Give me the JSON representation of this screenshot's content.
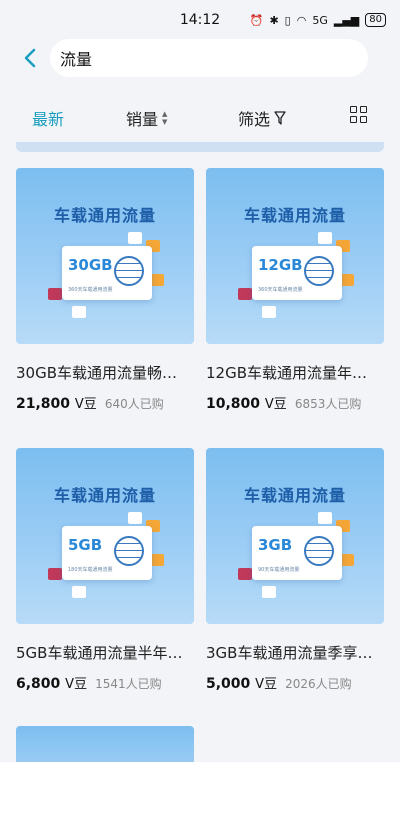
{
  "status": {
    "time": "14:12",
    "network": "5G",
    "battery": "80"
  },
  "header": {
    "search_text": "流量"
  },
  "filters": {
    "newest": "最新",
    "sales": "销量",
    "filter": "筛选"
  },
  "products": [
    {
      "image_title": "车载通用流量",
      "card_gb": "30GB",
      "card_sub": "360天车载通用流量",
      "name": "30GB车载通用流量畅…",
      "price": "21,800",
      "unit": "V豆",
      "sold": "640人已购"
    },
    {
      "image_title": "车载通用流量",
      "card_gb": "12GB",
      "card_sub": "360天车载通用流量",
      "name": "12GB车载通用流量年…",
      "price": "10,800",
      "unit": "V豆",
      "sold": "6853人已购"
    },
    {
      "image_title": "车载通用流量",
      "card_gb": "5GB",
      "card_sub": "180天车载通用流量",
      "name": "5GB车载通用流量半年…",
      "price": "6,800",
      "unit": "V豆",
      "sold": "1541人已购"
    },
    {
      "image_title": "车载通用流量",
      "card_gb": "3GB",
      "card_sub": "90天车载通用流量",
      "name": "3GB车载通用流量季享…",
      "price": "5,000",
      "unit": "V豆",
      "sold": "2026人已购"
    }
  ],
  "colors": {
    "accent": "#1a9ec0",
    "background": "#f2f4f7"
  }
}
